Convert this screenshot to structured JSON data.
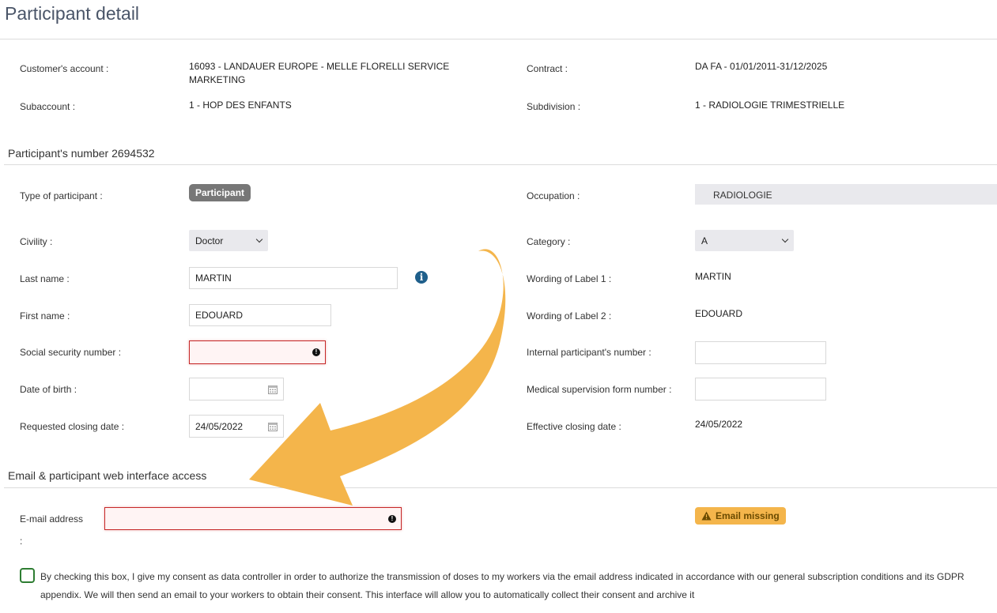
{
  "page": {
    "title": "Participant detail"
  },
  "account": {
    "customer_label": "Customer's account :",
    "customer_value": "16093 - LANDAUER EUROPE - MELLE FLORELLI SERVICE MARKETING",
    "contract_label": "Contract :",
    "contract_value": "DA FA - 01/01/2011-31/12/2025",
    "subaccount_label": "Subaccount :",
    "subaccount_value": "1 - HOP DES ENFANTS",
    "subdivision_label": "Subdivision :",
    "subdivision_value": "1 - RADIOLOGIE TRIMESTRIELLE"
  },
  "participant": {
    "section_title": "Participant's number 2694532",
    "type_label": "Type of participant :",
    "type_badge": "Participant",
    "occupation_label": "Occupation :",
    "occupation_value": "RADIOLOGIE",
    "civility_label": "Civility :",
    "civility_value": "Doctor",
    "category_label": "Category :",
    "category_value": "A",
    "last_name_label": "Last name :",
    "last_name_value": "MARTIN",
    "label1_label": "Wording of Label 1 :",
    "label1_value": "MARTIN",
    "first_name_label": "First name :",
    "first_name_value": "EDOUARD",
    "label2_label": "Wording of Label 2 :",
    "label2_value": "EDOUARD",
    "ssn_label": "Social security number :",
    "ssn_value": "",
    "internal_label": "Internal participant's number :",
    "internal_value": "",
    "dob_label": "Date of birth :",
    "dob_value": "",
    "medical_label": "Medical supervision form number :",
    "medical_value": "",
    "req_closing_label": "Requested closing date :",
    "req_closing_value": "24/05/2022",
    "eff_closing_label": "Effective closing date :",
    "eff_closing_value": "24/05/2022"
  },
  "email_section": {
    "title": "Email & participant web interface access",
    "email_label": "E-mail address",
    "email_colon": ":",
    "email_value": "",
    "warning": "Email missing",
    "consent_text": "By checking this box, I give my consent as data controller in order to authorize the transmission of doses to my workers via the email address indicated in accordance with our general subscription conditions and its GDPR appendix. We will then send an email to your workers to obtain their consent. This interface will allow you to automatically collect their consent and archive it"
  },
  "colors": {
    "arrow": "#f4b54b",
    "error": "#c62828",
    "badge": "#777777",
    "checkbox": "#2e7d32"
  },
  "icons": [
    "info-icon",
    "error-icon",
    "calendar-icon",
    "warning-icon",
    "chevron-down-icon"
  ]
}
